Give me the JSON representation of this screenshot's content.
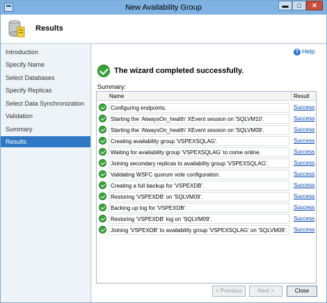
{
  "window": {
    "title": "New Availability Group",
    "minimize_glyph": "▬",
    "maximize_glyph": "□",
    "close_glyph": "✕"
  },
  "header": {
    "title": "Results",
    "icon": "database-wizard-icon"
  },
  "sidebar": {
    "items": [
      {
        "label": "Introduction",
        "active": false
      },
      {
        "label": "Specify Name",
        "active": false
      },
      {
        "label": "Select Databases",
        "active": false
      },
      {
        "label": "Specify Replicas",
        "active": false
      },
      {
        "label": "Select Data Synchronization",
        "active": false
      },
      {
        "label": "Validation",
        "active": false
      },
      {
        "label": "Summary",
        "active": false
      },
      {
        "label": "Results",
        "active": true
      }
    ]
  },
  "main": {
    "help_label": "Help",
    "status_message": "The wizard completed successfully.",
    "summary_label": "Summary:",
    "table": {
      "columns": [
        "Name",
        "Result"
      ],
      "rows": [
        {
          "name": "Configuring endpoints.",
          "result": "Success"
        },
        {
          "name": "Starting the 'AlwaysOn_health' XEvent session on 'SQLVM10'.",
          "result": "Success"
        },
        {
          "name": "Starting the 'AlwaysOn_health' XEvent session on 'SQLVM09'.",
          "result": "Success"
        },
        {
          "name": "Creating availability group 'VSPEXSQLAG'.",
          "result": "Success"
        },
        {
          "name": "Waiting for availability group 'VSPEXSQLAG' to come online.",
          "result": "Success"
        },
        {
          "name": "Joining secondary replicas to availability group 'VSPEXSQLAG'.",
          "result": "Success"
        },
        {
          "name": "Validating WSFC quorum vote configuration.",
          "result": "Success"
        },
        {
          "name": "Creating a full backup for 'VSPEXDB'.",
          "result": "Success"
        },
        {
          "name": "Restoring 'VSPEXDB' on 'SQLVM09'.",
          "result": "Success"
        },
        {
          "name": "Backing up log for 'VSPEXDB'.",
          "result": "Success"
        },
        {
          "name": "Restoring 'VSPEXDB' log on 'SQLVM09'.",
          "result": "Success"
        },
        {
          "name": "Joining 'VSPEXDB' to availability group 'VSPEXSQLAG' on 'SQLVM09'.",
          "result": "Success"
        }
      ]
    }
  },
  "footer": {
    "previous_label": "< Previous",
    "next_label": "Next >",
    "close_label": "Close"
  },
  "colors": {
    "accent": "#2f78c4",
    "success": "#38a43a",
    "link": "#0645ad"
  }
}
